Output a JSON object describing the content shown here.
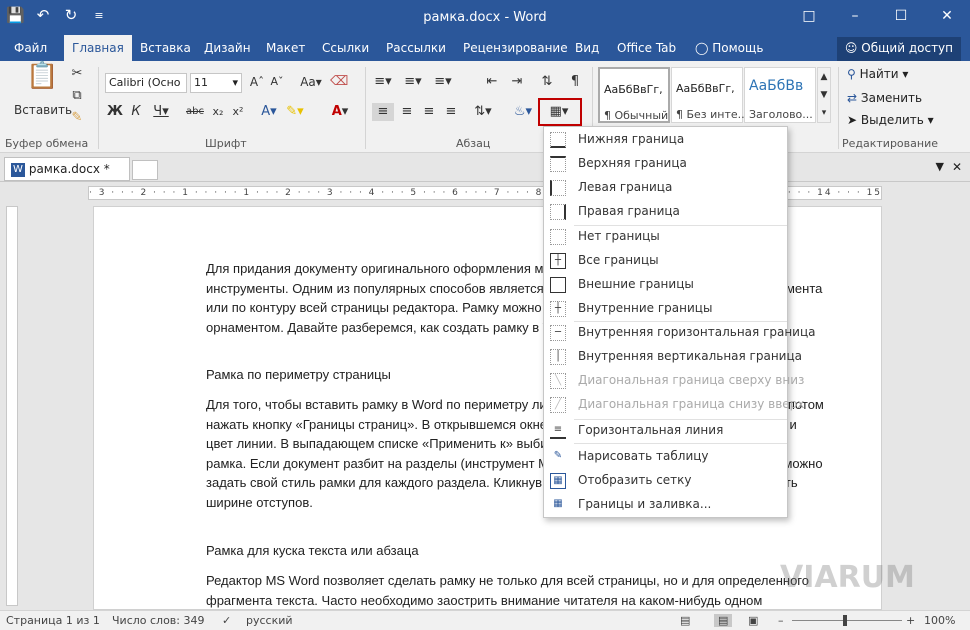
{
  "window": {
    "title": "рамка.docx - Word"
  },
  "qat": {
    "save_icon": "save-icon",
    "undo_icon": "undo-icon",
    "redo_icon": "redo-icon",
    "customize_icon": "customize-icon"
  },
  "tabs": [
    {
      "label": "Файл"
    },
    {
      "label": "Главная"
    },
    {
      "label": "Вставка"
    },
    {
      "label": "Дизайн"
    },
    {
      "label": "Макет"
    },
    {
      "label": "Ссылки"
    },
    {
      "label": "Рассылки"
    },
    {
      "label": "Рецензирование"
    },
    {
      "label": "Вид"
    },
    {
      "label": "Office Tab"
    },
    {
      "label": "Помощь"
    }
  ],
  "share_label": "Общий доступ",
  "ribbon": {
    "clipboard": {
      "paste_label": "Вставить",
      "group": "Буфер обмена"
    },
    "font": {
      "name": "Calibri (Осно",
      "size": "11",
      "group": "Шрифт"
    },
    "paragraph": {
      "group": "Абзац"
    },
    "styles": [
      {
        "sample": "АаБбВвГг,",
        "name": "¶ Обычный"
      },
      {
        "sample": "АаБбВвГг,",
        "name": "¶ Без инте..."
      },
      {
        "sample": "АаБбВв",
        "name": "Заголово..."
      }
    ],
    "editing": {
      "find": "Найти",
      "replace": "Заменить",
      "select": "Выделить",
      "group": "Редактирование"
    }
  },
  "doc_tab": {
    "label": "рамка.docx *"
  },
  "borders_menu": [
    {
      "label": "Нижняя граница",
      "enabled": true
    },
    {
      "label": "Верхняя граница",
      "enabled": true
    },
    {
      "label": "Левая граница",
      "enabled": true
    },
    {
      "label": "Правая граница",
      "enabled": true
    },
    {
      "label": "Нет границы",
      "enabled": true
    },
    {
      "label": "Все границы",
      "enabled": true
    },
    {
      "label": "Внешние границы",
      "enabled": true
    },
    {
      "label": "Внутренние границы",
      "enabled": true
    },
    {
      "label": "Внутренняя горизонтальная граница",
      "enabled": true
    },
    {
      "label": "Внутренняя вертикальная граница",
      "enabled": true
    },
    {
      "label": "Диагональная граница сверху вниз",
      "enabled": false
    },
    {
      "label": "Диагональная граница снизу вверх",
      "enabled": false
    },
    {
      "label": "Горизонтальная линия",
      "enabled": true
    },
    {
      "label": "Нарисовать таблицу",
      "enabled": true
    },
    {
      "label": "Отобразить сетку",
      "enabled": true
    },
    {
      "label": "Границы и заливка...",
      "enabled": true
    }
  ],
  "document": {
    "paragraphs": [
      "Для придания документу оригинального оформления могут использоваться самые разные инструменты. Одним из популярных способов является создание рамки вокруг текстового фрагмента или по контуру всей страницы редактора. Рамку можно сделать декоративной с каким-нибудь орнаментом. Давайте разберемся, как создать рамку в Word и придать ей нужный вид.",
      "Рамка по периметру страницы",
      "Для того, чтобы вставить рамку в Word по периметру листа, переходим на вкладку «Дизайн», а потом нажать кнопку «Границы страниц». В открывшемся окне задаем параметры рамки: тип, ширину и цвет линии. В выпадающем списке «Применить к» выбираем на каких именно страницах будет рамка. Если документ разбит на разделы (инструмент Макет – Разрывы – Разрывы разделов), можно задать свой стиль рамки для каждого раздела. Кликнув по кнопке «Параметры», можно изменить ширине отступов.",
      "Рамка для куска текста или абзаца",
      "Редактор MS Word позволяет сделать рамку не только для всей страницы, но и для определенного фрагмента текста. Часто необходимо заострить внимание читателя на каком-нибудь одном"
    ]
  },
  "status": {
    "page": "Страница 1 из 1",
    "words": "Число слов: 349",
    "language": "русский",
    "zoom": "100%"
  },
  "watermark": "VIARUM"
}
